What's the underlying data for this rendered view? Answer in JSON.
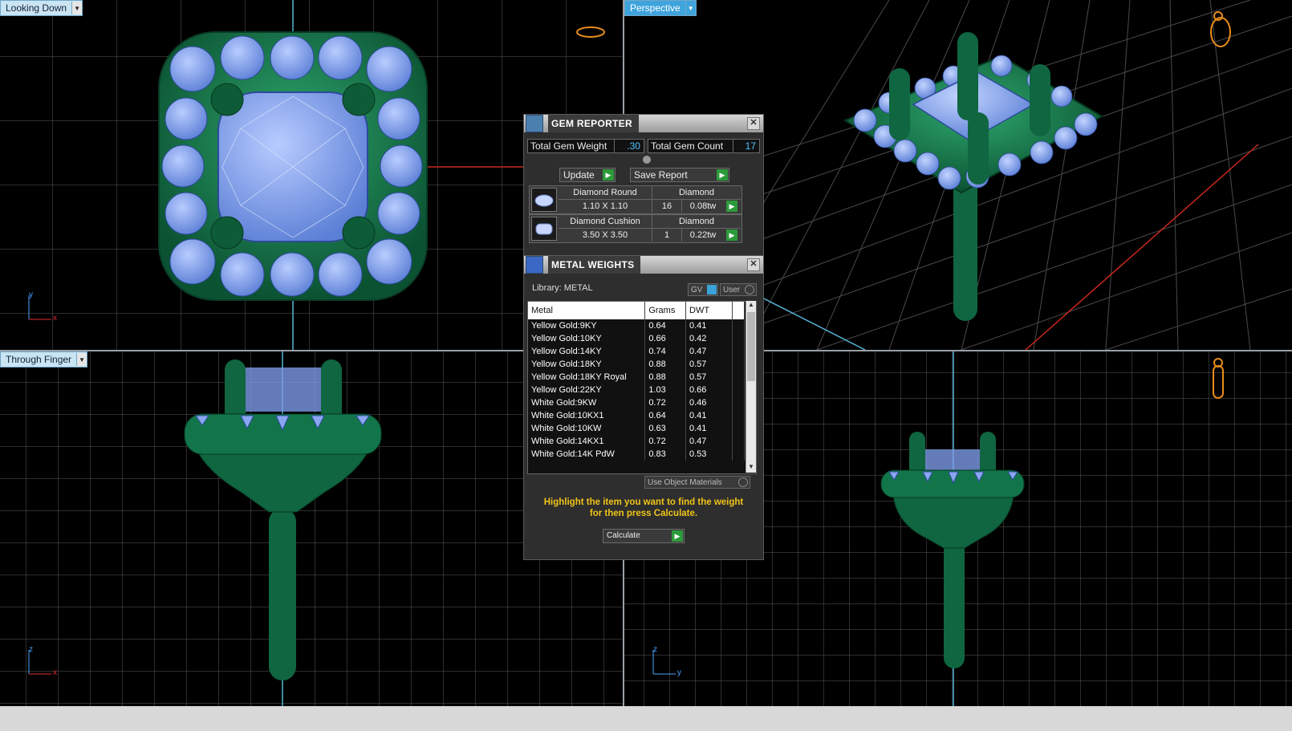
{
  "viewports": {
    "top_left": {
      "label": "Looking Down",
      "axis_v": "y",
      "axis_h": "x"
    },
    "top_right": {
      "label": "Perspective"
    },
    "bottom_left": {
      "label": "Through Finger",
      "axis_v": "z",
      "axis_h": "x"
    },
    "bottom_right": {
      "axis_v": "z",
      "axis_h": "y"
    }
  },
  "gem_reporter": {
    "title": "GEM REPORTER",
    "total_weight_label": "Total Gem Weight",
    "total_weight_value": ".30",
    "total_count_label": "Total Gem Count",
    "total_count_value": "17",
    "update_label": "Update",
    "save_report_label": "Save Report",
    "gems": [
      {
        "name": "Diamond Round",
        "material": "Diamond",
        "size": "1.10 X 1.10",
        "count": "16",
        "weight": "0.08tw"
      },
      {
        "name": "Diamond Cushion",
        "material": "Diamond",
        "size": "3.50 X 3.50",
        "count": "1",
        "weight": "0.22tw"
      }
    ]
  },
  "metal_weights": {
    "title": "METAL WEIGHTS",
    "library_label": "Library: METAL",
    "toggle_gv": "GV",
    "toggle_user": "User",
    "columns": [
      "Metal",
      "Grams",
      "DWT"
    ],
    "rows": [
      {
        "metal": "Yellow Gold:9KY",
        "grams": "0.64",
        "dwt": "0.41"
      },
      {
        "metal": "Yellow Gold:10KY",
        "grams": "0.66",
        "dwt": "0.42"
      },
      {
        "metal": "Yellow Gold:14KY",
        "grams": "0.74",
        "dwt": "0.47"
      },
      {
        "metal": "Yellow Gold:18KY",
        "grams": "0.88",
        "dwt": "0.57"
      },
      {
        "metal": "Yellow Gold:18KY Royal",
        "grams": "0.88",
        "dwt": "0.57"
      },
      {
        "metal": "Yellow Gold:22KY",
        "grams": "1.03",
        "dwt": "0.66"
      },
      {
        "metal": "White Gold:9KW",
        "grams": "0.72",
        "dwt": "0.46"
      },
      {
        "metal": "White Gold:10KX1",
        "grams": "0.64",
        "dwt": "0.41"
      },
      {
        "metal": "White Gold:10KW",
        "grams": "0.63",
        "dwt": "0.41"
      },
      {
        "metal": "White Gold:14KX1",
        "grams": "0.72",
        "dwt": "0.47"
      },
      {
        "metal": "White Gold:14K PdW",
        "grams": "0.83",
        "dwt": "0.53"
      }
    ],
    "use_object_materials_label": "Use Object Materials",
    "hint": "Highlight the item you want to find the weight for then press Calculate.",
    "calculate_label": "Calculate"
  }
}
